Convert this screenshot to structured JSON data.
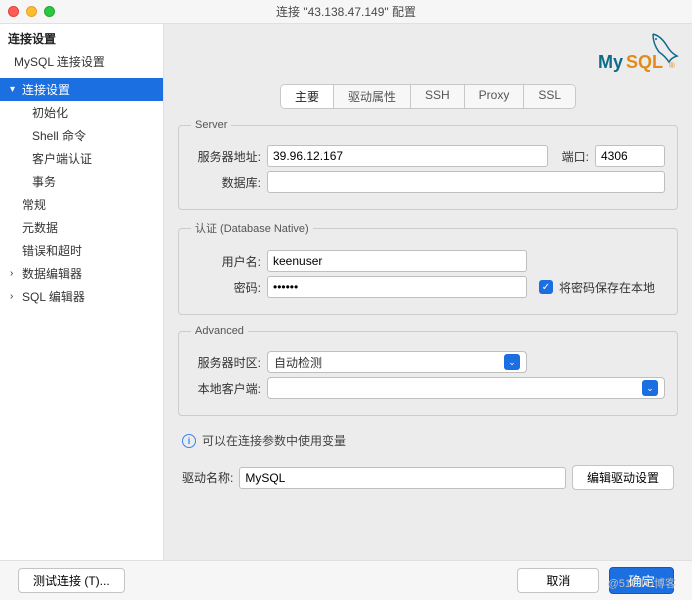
{
  "window": {
    "title": "连接 \"43.138.47.149\" 配置"
  },
  "sidebar": {
    "header": "连接设置",
    "subheader": "MySQL 连接设置",
    "items": [
      {
        "label": "连接设置",
        "arrow": "▾",
        "selected": true
      },
      {
        "label": "初始化",
        "child": true
      },
      {
        "label": "Shell 命令",
        "child": true
      },
      {
        "label": "客户端认证",
        "child": true
      },
      {
        "label": "事务",
        "child": true
      },
      {
        "label": "常规",
        "arrow": ""
      },
      {
        "label": "元数据",
        "arrow": ""
      },
      {
        "label": "错误和超时",
        "arrow": ""
      },
      {
        "label": "数据编辑器",
        "arrow": "›"
      },
      {
        "label": "SQL 编辑器",
        "arrow": "›"
      }
    ]
  },
  "tabs": {
    "items": [
      "主要",
      "驱动属性",
      "SSH",
      "Proxy",
      "SSL"
    ],
    "active": 0
  },
  "server": {
    "legend": "Server",
    "host_lbl": "服务器地址:",
    "host": "39.96.12.167",
    "port_lbl": "端口:",
    "port": "4306",
    "db_lbl": "数据库:",
    "db": ""
  },
  "auth": {
    "legend": "认证 (Database Native)",
    "user_lbl": "用户名:",
    "user": "keenuser",
    "pass_lbl": "密码:",
    "pass": "••••••",
    "save_lbl": "将密码保存在本地"
  },
  "advanced": {
    "legend": "Advanced",
    "tz_lbl": "服务器时区:",
    "tz_val": "自动检测",
    "local_lbl": "本地客户端:",
    "local_val": ""
  },
  "info": {
    "text": "可以在连接参数中使用变量"
  },
  "driver": {
    "lbl": "驱动名称:",
    "name": "MySQL",
    "edit_btn": "编辑驱动设置"
  },
  "footer": {
    "test": "测试连接 (T)...",
    "cancel": "取消",
    "ok": "确定"
  },
  "watermark": "@51CTO博客",
  "logo": {
    "text": "MySQL",
    "dot": "®"
  }
}
